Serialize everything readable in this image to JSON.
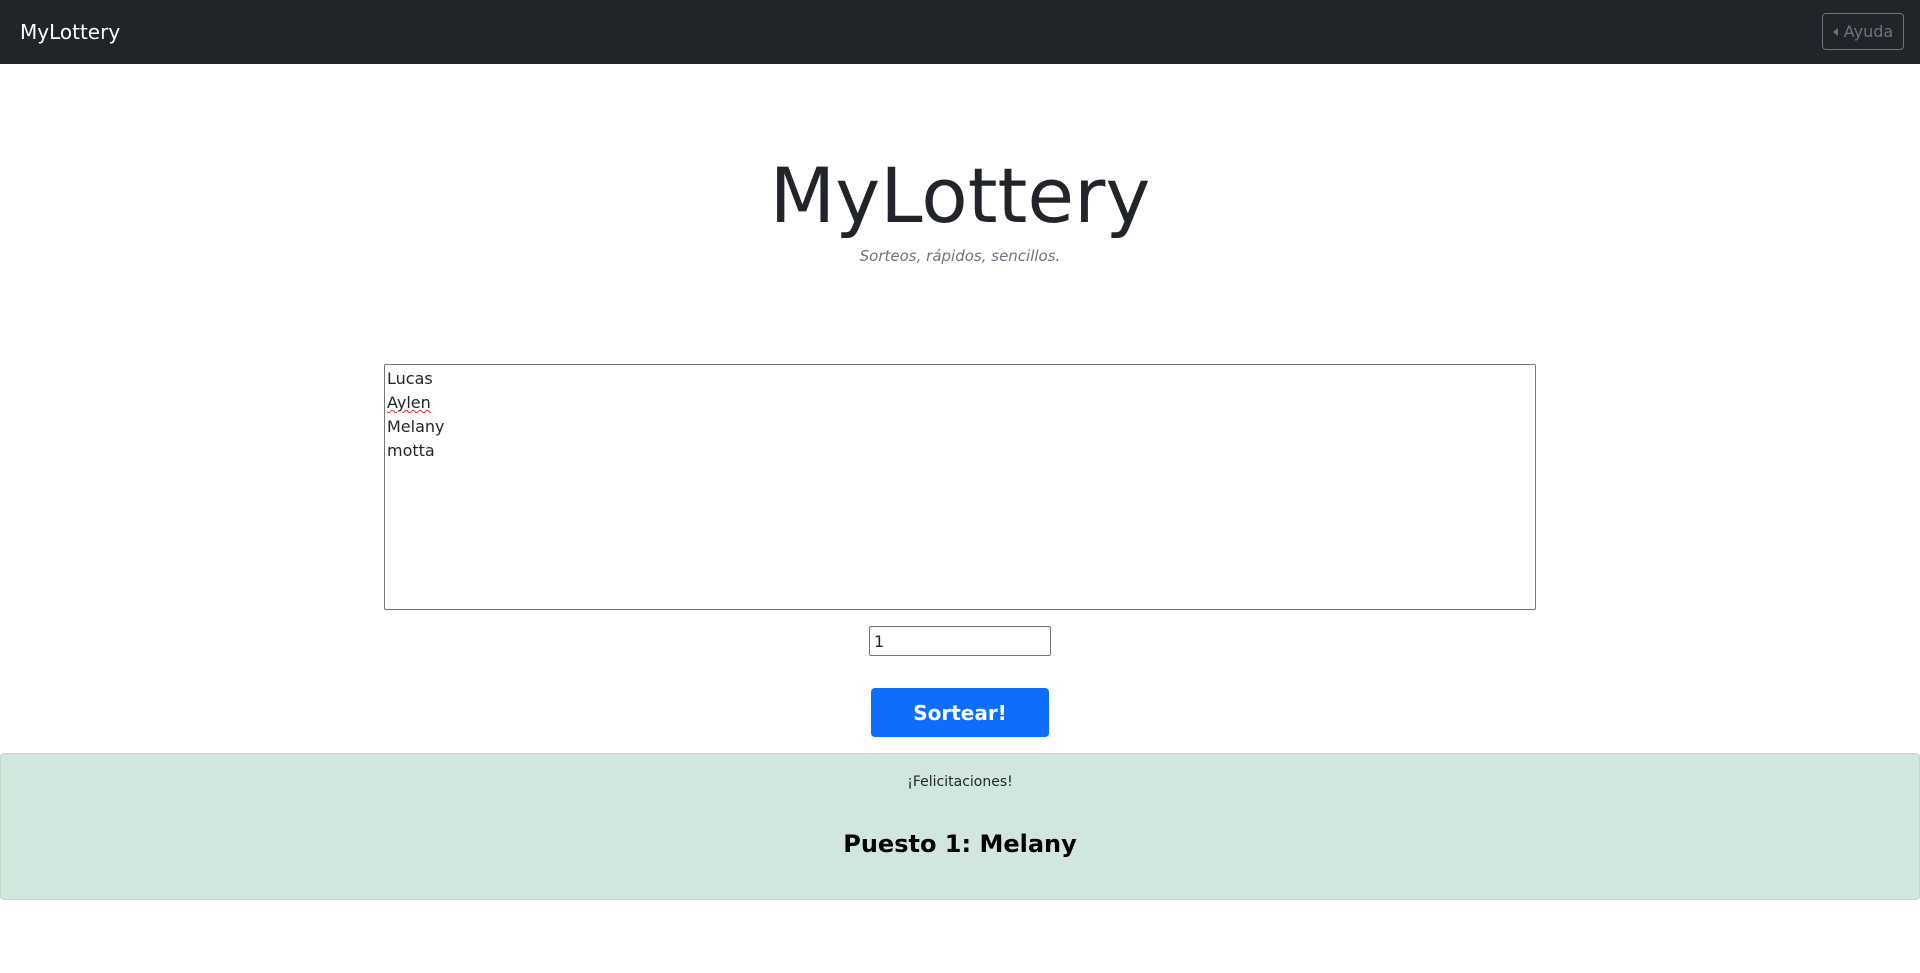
{
  "navbar": {
    "brand": "MyLottery",
    "help_label": "Ayuda",
    "help_icon": "caret-left-icon"
  },
  "hero": {
    "title": "MyLottery",
    "subtitle": "Sorteos, rápidos, sencillos."
  },
  "form": {
    "participants": [
      "Lucas",
      "Aylen",
      "Melany",
      "motta"
    ],
    "winners_count": "1",
    "submit_label": "Sortear!"
  },
  "result": {
    "congrats": "¡Felicitaciones!",
    "winner_line": "Puesto 1: Melany"
  },
  "colors": {
    "navbar_bg": "#212529",
    "primary": "#0d6efd",
    "success_bg": "#d1e7dd"
  }
}
